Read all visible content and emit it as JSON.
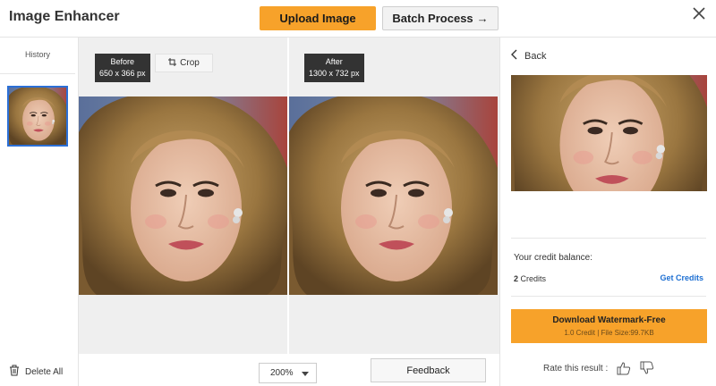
{
  "header": {
    "app_title": "Image Enhancer",
    "upload_label": "Upload Image",
    "batch_label": "Batch Process",
    "batch_arrow": "→",
    "close_glyph": "✕"
  },
  "sidebar": {
    "history_label": "History",
    "delete_label": "Delete All"
  },
  "compare": {
    "before": {
      "tag_title": "Before",
      "tag_size": "650 x 366 px"
    },
    "after": {
      "tag_title": "After",
      "tag_size": "1300 x 732 px"
    },
    "crop_label": "Crop"
  },
  "bottom": {
    "zoom_value": "200%",
    "feedback_label": "Feedback"
  },
  "right": {
    "back_label": "Back",
    "credit_label": "Your credit balance:",
    "credit_number": "2",
    "credit_unit": "Credits",
    "get_credits_label": "Get Credits",
    "download_main": "Download Watermark-Free",
    "download_sub": "1.0 Credit | File Size:99.7KB",
    "rate_label": "Rate this result :"
  },
  "colors": {
    "accent_orange": "#f7a22a",
    "link_blue": "#1d6fd2",
    "selected_border": "#2b6fd6"
  },
  "icons": [
    "close-icon",
    "trash-icon",
    "crop-icon",
    "chevron-left-icon",
    "caret-down-icon",
    "thumbs-up-icon",
    "thumbs-down-icon"
  ]
}
